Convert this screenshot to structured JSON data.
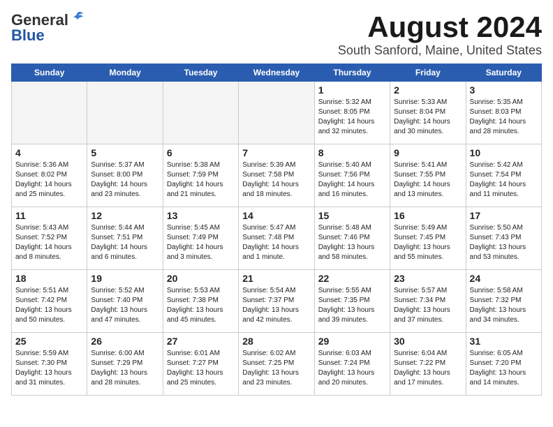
{
  "header": {
    "logo_line1": "General",
    "logo_line2": "Blue",
    "title": "August 2024",
    "subtitle": "South Sanford, Maine, United States"
  },
  "weekdays": [
    "Sunday",
    "Monday",
    "Tuesday",
    "Wednesday",
    "Thursday",
    "Friday",
    "Saturday"
  ],
  "weeks": [
    [
      {
        "day": "",
        "info": ""
      },
      {
        "day": "",
        "info": ""
      },
      {
        "day": "",
        "info": ""
      },
      {
        "day": "",
        "info": ""
      },
      {
        "day": "1",
        "info": "Sunrise: 5:32 AM\nSunset: 8:05 PM\nDaylight: 14 hours\nand 32 minutes."
      },
      {
        "day": "2",
        "info": "Sunrise: 5:33 AM\nSunset: 8:04 PM\nDaylight: 14 hours\nand 30 minutes."
      },
      {
        "day": "3",
        "info": "Sunrise: 5:35 AM\nSunset: 8:03 PM\nDaylight: 14 hours\nand 28 minutes."
      }
    ],
    [
      {
        "day": "4",
        "info": "Sunrise: 5:36 AM\nSunset: 8:02 PM\nDaylight: 14 hours\nand 25 minutes."
      },
      {
        "day": "5",
        "info": "Sunrise: 5:37 AM\nSunset: 8:00 PM\nDaylight: 14 hours\nand 23 minutes."
      },
      {
        "day": "6",
        "info": "Sunrise: 5:38 AM\nSunset: 7:59 PM\nDaylight: 14 hours\nand 21 minutes."
      },
      {
        "day": "7",
        "info": "Sunrise: 5:39 AM\nSunset: 7:58 PM\nDaylight: 14 hours\nand 18 minutes."
      },
      {
        "day": "8",
        "info": "Sunrise: 5:40 AM\nSunset: 7:56 PM\nDaylight: 14 hours\nand 16 minutes."
      },
      {
        "day": "9",
        "info": "Sunrise: 5:41 AM\nSunset: 7:55 PM\nDaylight: 14 hours\nand 13 minutes."
      },
      {
        "day": "10",
        "info": "Sunrise: 5:42 AM\nSunset: 7:54 PM\nDaylight: 14 hours\nand 11 minutes."
      }
    ],
    [
      {
        "day": "11",
        "info": "Sunrise: 5:43 AM\nSunset: 7:52 PM\nDaylight: 14 hours\nand 8 minutes."
      },
      {
        "day": "12",
        "info": "Sunrise: 5:44 AM\nSunset: 7:51 PM\nDaylight: 14 hours\nand 6 minutes."
      },
      {
        "day": "13",
        "info": "Sunrise: 5:45 AM\nSunset: 7:49 PM\nDaylight: 14 hours\nand 3 minutes."
      },
      {
        "day": "14",
        "info": "Sunrise: 5:47 AM\nSunset: 7:48 PM\nDaylight: 14 hours\nand 1 minute."
      },
      {
        "day": "15",
        "info": "Sunrise: 5:48 AM\nSunset: 7:46 PM\nDaylight: 13 hours\nand 58 minutes."
      },
      {
        "day": "16",
        "info": "Sunrise: 5:49 AM\nSunset: 7:45 PM\nDaylight: 13 hours\nand 55 minutes."
      },
      {
        "day": "17",
        "info": "Sunrise: 5:50 AM\nSunset: 7:43 PM\nDaylight: 13 hours\nand 53 minutes."
      }
    ],
    [
      {
        "day": "18",
        "info": "Sunrise: 5:51 AM\nSunset: 7:42 PM\nDaylight: 13 hours\nand 50 minutes."
      },
      {
        "day": "19",
        "info": "Sunrise: 5:52 AM\nSunset: 7:40 PM\nDaylight: 13 hours\nand 47 minutes."
      },
      {
        "day": "20",
        "info": "Sunrise: 5:53 AM\nSunset: 7:38 PM\nDaylight: 13 hours\nand 45 minutes."
      },
      {
        "day": "21",
        "info": "Sunrise: 5:54 AM\nSunset: 7:37 PM\nDaylight: 13 hours\nand 42 minutes."
      },
      {
        "day": "22",
        "info": "Sunrise: 5:55 AM\nSunset: 7:35 PM\nDaylight: 13 hours\nand 39 minutes."
      },
      {
        "day": "23",
        "info": "Sunrise: 5:57 AM\nSunset: 7:34 PM\nDaylight: 13 hours\nand 37 minutes."
      },
      {
        "day": "24",
        "info": "Sunrise: 5:58 AM\nSunset: 7:32 PM\nDaylight: 13 hours\nand 34 minutes."
      }
    ],
    [
      {
        "day": "25",
        "info": "Sunrise: 5:59 AM\nSunset: 7:30 PM\nDaylight: 13 hours\nand 31 minutes."
      },
      {
        "day": "26",
        "info": "Sunrise: 6:00 AM\nSunset: 7:29 PM\nDaylight: 13 hours\nand 28 minutes."
      },
      {
        "day": "27",
        "info": "Sunrise: 6:01 AM\nSunset: 7:27 PM\nDaylight: 13 hours\nand 25 minutes."
      },
      {
        "day": "28",
        "info": "Sunrise: 6:02 AM\nSunset: 7:25 PM\nDaylight: 13 hours\nand 23 minutes."
      },
      {
        "day": "29",
        "info": "Sunrise: 6:03 AM\nSunset: 7:24 PM\nDaylight: 13 hours\nand 20 minutes."
      },
      {
        "day": "30",
        "info": "Sunrise: 6:04 AM\nSunset: 7:22 PM\nDaylight: 13 hours\nand 17 minutes."
      },
      {
        "day": "31",
        "info": "Sunrise: 6:05 AM\nSunset: 7:20 PM\nDaylight: 13 hours\nand 14 minutes."
      }
    ]
  ]
}
